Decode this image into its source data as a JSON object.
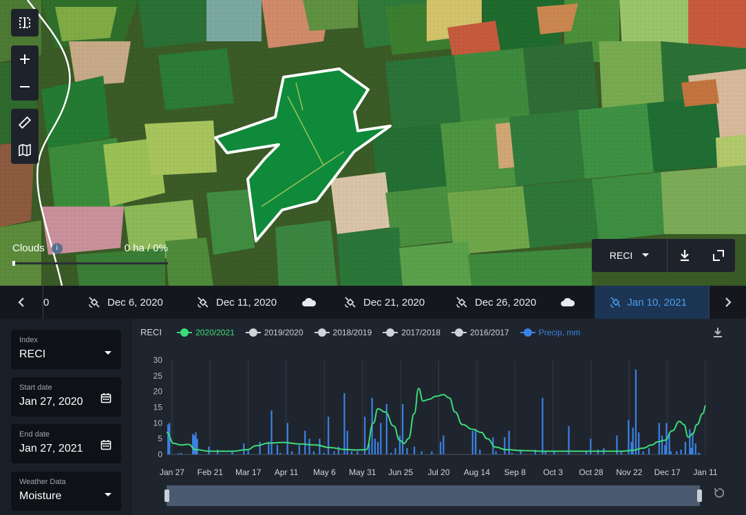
{
  "map": {
    "clouds_label": "Clouds",
    "clouds_info": "i",
    "clouds_value": "0 ha / 0%",
    "clouds_fraction": 0,
    "index_select": "RECI",
    "controls": [
      "split-view-icon",
      "zoom-in-icon",
      "zoom-out-icon",
      "ruler-icon",
      "map-layers-icon"
    ]
  },
  "dates": {
    "items": [
      {
        "label": "0",
        "icon": "none"
      },
      {
        "label": "Dec 6, 2020",
        "icon": "satellite-icon"
      },
      {
        "label": "Dec 11, 2020",
        "icon": "satellite-icon"
      },
      {
        "label": "",
        "icon": "cloud-icon"
      },
      {
        "label": "Dec 21, 2020",
        "icon": "satellite-icon"
      },
      {
        "label": "Dec 26, 2020",
        "icon": "satellite-icon"
      },
      {
        "label": "",
        "icon": "cloud-icon"
      },
      {
        "label": "Jan 10, 2021",
        "icon": "satellite-icon",
        "active": true
      }
    ]
  },
  "sidebar": {
    "index_label": "Index",
    "index_value": "RECI",
    "start_label": "Start date",
    "start_value": "Jan 27, 2020",
    "end_label": "End date",
    "end_value": "Jan 27, 2021",
    "weather_label": "Weather Data",
    "weather_value": "Moisture"
  },
  "colors": {
    "accent": "#4a9ef0",
    "reci_line": "#3ddc7a",
    "precip_bar": "#3b82e6",
    "legend_gray": "#cfd3d8"
  },
  "chart_data": {
    "type": "line",
    "title": "RECI",
    "legend": [
      {
        "name": "2020/2021",
        "color": "#3ddc7a"
      },
      {
        "name": "2019/2020",
        "color": "#cfd3d8"
      },
      {
        "name": "2018/2019",
        "color": "#cfd3d8"
      },
      {
        "name": "2017/2018",
        "color": "#cfd3d8"
      },
      {
        "name": "2016/2017",
        "color": "#cfd3d8"
      },
      {
        "name": "Precip, mm",
        "color": "#3b82e6"
      }
    ],
    "y_ticks": [
      0,
      5,
      10,
      15,
      20,
      25,
      30
    ],
    "ylim": [
      0,
      30
    ],
    "x_ticks": [
      "Jan 27",
      "Feb 21",
      "Mar 17",
      "Apr 11",
      "May 6",
      "May 31",
      "Jun 25",
      "Jul 20",
      "Aug 14",
      "Sep 8",
      "Oct 3",
      "Oct 28",
      "Nov 22",
      "Dec 17",
      "Jan 11"
    ],
    "x_range_days": [
      0,
      366
    ],
    "series": [
      {
        "name": "2020/2021",
        "type": "line",
        "points": [
          [
            0,
            7
          ],
          [
            5,
            3.5
          ],
          [
            10,
            3
          ],
          [
            15,
            3.2
          ],
          [
            20,
            1.5
          ],
          [
            30,
            1
          ],
          [
            45,
            1
          ],
          [
            55,
            1.5
          ],
          [
            62,
            2.8
          ],
          [
            70,
            3.6
          ],
          [
            80,
            3.8
          ],
          [
            92,
            3.3
          ],
          [
            102,
            3
          ],
          [
            112,
            2.2
          ],
          [
            122,
            1.6
          ],
          [
            130,
            1.4
          ],
          [
            137,
            1.5
          ],
          [
            142,
            10
          ],
          [
            145,
            14.5
          ],
          [
            150,
            13.5
          ],
          [
            156,
            9
          ],
          [
            160,
            4.5
          ],
          [
            163,
            3.5
          ],
          [
            166,
            5
          ],
          [
            170,
            13
          ],
          [
            173,
            21
          ],
          [
            176,
            17
          ],
          [
            180,
            17.5
          ],
          [
            185,
            18.5
          ],
          [
            190,
            19
          ],
          [
            194,
            18
          ],
          [
            198,
            13.5
          ],
          [
            203,
            9.5
          ],
          [
            210,
            8
          ],
          [
            216,
            7
          ],
          [
            220,
            5
          ],
          [
            226,
            2.3
          ],
          [
            233,
            1.5
          ],
          [
            245,
            1.2
          ],
          [
            260,
            1
          ],
          [
            280,
            1
          ],
          [
            300,
            1
          ],
          [
            312,
            1
          ],
          [
            320,
            1.3
          ],
          [
            327,
            2
          ],
          [
            333,
            3
          ],
          [
            337,
            4
          ],
          [
            342,
            4.5
          ],
          [
            347,
            7.5
          ],
          [
            352,
            10.5
          ],
          [
            355,
            9.5
          ],
          [
            358,
            5.5
          ],
          [
            361,
            6.5
          ],
          [
            364,
            9.5
          ],
          [
            368,
            13
          ],
          [
            370,
            15.5
          ]
        ]
      },
      {
        "name": "Precip, mm",
        "type": "bar",
        "points": [
          [
            1,
            9.5
          ],
          [
            2,
            10
          ],
          [
            8,
            0.3
          ],
          [
            10,
            0.5
          ],
          [
            18,
            6.5
          ],
          [
            19,
            6
          ],
          [
            20,
            7
          ],
          [
            21,
            5
          ],
          [
            29,
            2.5
          ],
          [
            35,
            1.5
          ],
          [
            45,
            1
          ],
          [
            53,
            3.5
          ],
          [
            56,
            1.5
          ],
          [
            64,
            4
          ],
          [
            70,
            4
          ],
          [
            72,
            14
          ],
          [
            76,
            3
          ],
          [
            78,
            0.5
          ],
          [
            83,
            10
          ],
          [
            86,
            1
          ],
          [
            91,
            3
          ],
          [
            95,
            7.5
          ],
          [
            98,
            5
          ],
          [
            101,
            1
          ],
          [
            105,
            5
          ],
          [
            108,
            0.5
          ],
          [
            111,
            12
          ],
          [
            115,
            1
          ],
          [
            118,
            2.5
          ],
          [
            122,
            19.5
          ],
          [
            124,
            7.5
          ],
          [
            127,
            1
          ],
          [
            131,
            1
          ],
          [
            136,
            12
          ],
          [
            139,
            3.5
          ],
          [
            141,
            18
          ],
          [
            143,
            5
          ],
          [
            145,
            4
          ],
          [
            147,
            10
          ],
          [
            151,
            16
          ],
          [
            154,
            0.5
          ],
          [
            157,
            2
          ],
          [
            160,
            6
          ],
          [
            162,
            16
          ],
          [
            165,
            2
          ],
          [
            170,
            2.5
          ],
          [
            175,
            1
          ],
          [
            182,
            1
          ],
          [
            188,
            4
          ],
          [
            190,
            6
          ],
          [
            210,
            7.5
          ],
          [
            212,
            8
          ],
          [
            215,
            1.5
          ],
          [
            224,
            5.5
          ],
          [
            226,
            1
          ],
          [
            232,
            5.5
          ],
          [
            235,
            7.5
          ],
          [
            237,
            0.5
          ],
          [
            243,
            1.5
          ],
          [
            253,
            1.5
          ],
          [
            258,
            18
          ],
          [
            260,
            1
          ],
          [
            266,
            1
          ],
          [
            276,
            9
          ],
          [
            288,
            1
          ],
          [
            291,
            5
          ],
          [
            296,
            1.5
          ],
          [
            300,
            2
          ],
          [
            309,
            6
          ],
          [
            312,
            1
          ],
          [
            317,
            11
          ],
          [
            319,
            4
          ],
          [
            320,
            8.5
          ],
          [
            322,
            27
          ],
          [
            324,
            7
          ],
          [
            327,
            1
          ],
          [
            331,
            2
          ],
          [
            338,
            10
          ],
          [
            340,
            6
          ],
          [
            342,
            3
          ],
          [
            343,
            10
          ],
          [
            345,
            7
          ],
          [
            346,
            1
          ],
          [
            350,
            1
          ],
          [
            353,
            1.5
          ],
          [
            356,
            4
          ],
          [
            359,
            8
          ],
          [
            360,
            2
          ],
          [
            361,
            7
          ],
          [
            363,
            3.5
          ],
          [
            365,
            0.5
          ],
          [
            366,
            0.3
          ]
        ]
      }
    ]
  }
}
